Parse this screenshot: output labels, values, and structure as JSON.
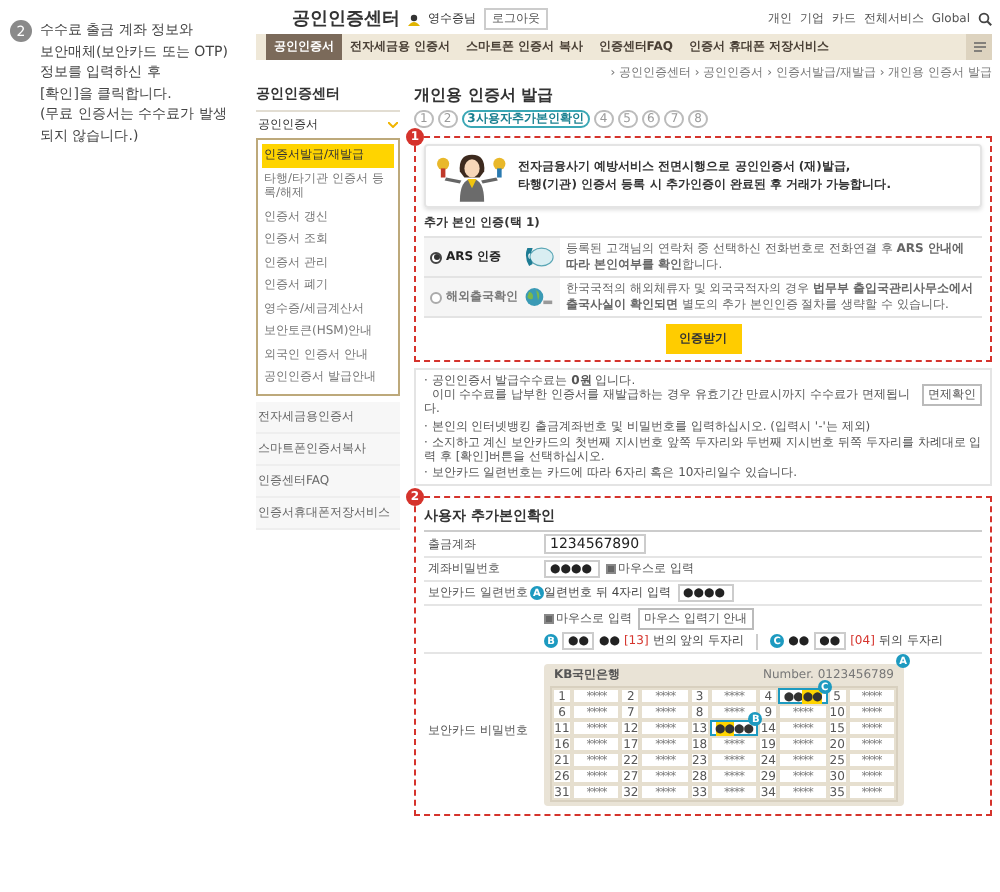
{
  "instruction": {
    "step": "2",
    "text": "수수료 출금 계좌 정보와\n보안매체(보안카드 또는 OTP)\n정보를 입력하신 후\n[확인]을 클릭합니다.\n(무료 인증서는 수수료가 발생\n되지 않습니다.)"
  },
  "header": {
    "logo": "공인인증센터",
    "user": "영수증님",
    "logout": "로그아웃",
    "links": [
      "개인",
      "기업",
      "카드",
      "전체서비스",
      "Global"
    ]
  },
  "nav": {
    "tabs": [
      {
        "label": "공인인증서",
        "selected": true
      },
      {
        "label": "전자세금용 인증서",
        "selected": false
      },
      {
        "label": "스마트폰 인증서 복사",
        "selected": false
      },
      {
        "label": "인증센터FAQ",
        "selected": false
      },
      {
        "label": "인증서 휴대폰 저장서비스",
        "selected": false
      }
    ]
  },
  "breadcrumb": "› 공인인증센터 › 공인인증서 › 인증서발급/재발급 › 개인용 인증서 발급",
  "sidebar": {
    "title": "공인인증센터",
    "dropdown": {
      "label": "공인인증서",
      "expanded": true
    },
    "submenu": [
      {
        "label": "인증서발급/재발급",
        "selected": true
      },
      {
        "label": "타행/타기관 인증서 등록/해제",
        "selected": false
      },
      {
        "label": "인증서 갱신",
        "selected": false
      },
      {
        "label": "인증서 조회",
        "selected": false
      },
      {
        "label": "인증서 관리",
        "selected": false
      },
      {
        "label": "인증서 폐기",
        "selected": false
      },
      {
        "label": "영수증/세금계산서",
        "selected": false
      },
      {
        "label": "보안토큰(HSM)안내",
        "selected": false
      },
      {
        "label": "외국인 인증서 안내",
        "selected": false
      },
      {
        "label": "공인인증서 발급안내",
        "selected": false
      }
    ],
    "items": [
      "전자세금용인증서",
      "스마트폰인증서복사",
      "인증센터FAQ",
      "인증서휴대폰저장서비스"
    ]
  },
  "main": {
    "title": "개인용 인증서 발급",
    "steps": [
      {
        "label": "1",
        "selected": false
      },
      {
        "label": "2",
        "selected": false
      },
      {
        "label": "3사용자추가본인확인",
        "selected": true
      },
      {
        "label": "4",
        "selected": false
      },
      {
        "label": "5",
        "selected": false
      },
      {
        "label": "6",
        "selected": false
      },
      {
        "label": "7",
        "selected": false
      },
      {
        "label": "8",
        "selected": false
      }
    ],
    "section1": {
      "marker": "1",
      "notice": [
        "전자금융사기 예방서비스 전면시행으로 공인인증서 (재)발급,",
        "타행(기관) 인증서 등록 시 **추가인증이 완료된 후 거래**가 가능합니다."
      ],
      "subheading": "추가 본인 인증(택 1)",
      "options": [
        {
          "kind": "phone",
          "label": "ARS 인증",
          "selected": true,
          "description": "등록된 고객님의 연락처 중 선택하신 전화번호로 전화연결 후 **ARS 안내에 따라 본인여부를 확인**합니다."
        },
        {
          "kind": "globe",
          "label": "해외출국확인",
          "selected": false,
          "description": "한국국적의 해외체류자 및 외국국적자의 경우 **법무부 출입국관리사무소에서 출국사실이 확인되면** 별도의 추가 본인인증 절차를 생략할 수 있습니다."
        }
      ],
      "button": "인증받기"
    },
    "notes": [
      {
        "text": "· 공인인증서 발급수수료는 **0원** 입니다.\n  이미 수수료를 납부한 인증서를 재발급하는 경우 유효기간 만료시까지 수수료가 면제됩니다.",
        "button": "면제확인"
      },
      {
        "text": "· 본인의 인터넷뱅킹 출금계좌번호 및 비밀번호를 입력하십시오. (입력시 '-'는 제외)"
      },
      {
        "text": "· 소지하고 계신 보안카드의 첫번째 지시번호 앞쪽 두자리와 두번째 지시번호 뒤쪽 두자리를 차례대로 입력 후 [확인]버튼을 선택하십시오."
      },
      {
        "text": "· 보안카드 일련번호는 카드에 따라 6자리 혹은 10자리일수 있습니다."
      }
    ],
    "section2": {
      "marker": "2",
      "heading": "사용자 추가본인확인",
      "account": {
        "label": "출금계좌",
        "value": "1234567890"
      },
      "password": {
        "label": "계좌비밀번호",
        "value": "●●●●",
        "checkbox": {
          "label": "마우스로 입력",
          "checked": true
        }
      },
      "serial": {
        "label": "보안카드 일련번호",
        "badge": "A",
        "hint": "일련번호 뒤 4자리 입력",
        "value": "●●●●"
      },
      "mouse": {
        "checkbox": {
          "label": "마우스로 입력",
          "checked": true
        },
        "guide": "마우스 입력기 안내"
      },
      "codes": [
        {
          "badge": "B",
          "first": "●●",
          "second": "●●",
          "entry_first": true,
          "index": "[13]",
          "label": "번의 앞의 두자리"
        },
        {
          "badge": "C",
          "first": "●●",
          "second": "●●",
          "entry_first": false,
          "index": "[04]",
          "label": "뒤의 두자리"
        }
      ],
      "card": {
        "label": "보안카드 비밀번호",
        "bank": "KB국민은행",
        "number": "Number. 0123456789",
        "badge": "A",
        "cells": [
          {
            "no": "1",
            "value": "****"
          },
          {
            "no": "2",
            "value": "****"
          },
          {
            "no": "3",
            "value": "****"
          },
          {
            "no": "4",
            "value": "●●",
            "marked": "●●",
            "marked_first": false,
            "badge": "C"
          },
          {
            "no": "5",
            "value": "****"
          },
          {
            "no": "6",
            "value": "****"
          },
          {
            "no": "7",
            "value": "****"
          },
          {
            "no": "8",
            "value": "****"
          },
          {
            "no": "9",
            "value": "****"
          },
          {
            "no": "10",
            "value": "****"
          },
          {
            "no": "11",
            "value": "****"
          },
          {
            "no": "12",
            "value": "****"
          },
          {
            "no": "13",
            "value": "●●",
            "marked": "●●",
            "marked_first": true,
            "badge": "B"
          },
          {
            "no": "14",
            "value": "****"
          },
          {
            "no": "15",
            "value": "****"
          },
          {
            "no": "16",
            "value": "****"
          },
          {
            "no": "17",
            "value": "****"
          },
          {
            "no": "18",
            "value": "****"
          },
          {
            "no": "19",
            "value": "****"
          },
          {
            "no": "20",
            "value": "****"
          },
          {
            "no": "21",
            "value": "****"
          },
          {
            "no": "22",
            "value": "****"
          },
          {
            "no": "23",
            "value": "****"
          },
          {
            "no": "24",
            "value": "****"
          },
          {
            "no": "25",
            "value": "****"
          },
          {
            "no": "26",
            "value": "****"
          },
          {
            "no": "27",
            "value": "****"
          },
          {
            "no": "28",
            "value": "****"
          },
          {
            "no": "29",
            "value": "****"
          },
          {
            "no": "30",
            "value": "****"
          },
          {
            "no": "31",
            "value": "****"
          },
          {
            "no": "32",
            "value": "****"
          },
          {
            "no": "33",
            "value": "****"
          },
          {
            "no": "34",
            "value": "****"
          },
          {
            "no": "35",
            "value": "****"
          }
        ]
      }
    }
  }
}
